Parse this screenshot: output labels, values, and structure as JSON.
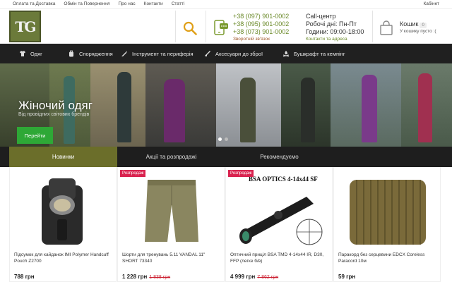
{
  "topbar": {
    "links": [
      "Оплата та Доставка",
      "Обмін та Повернення",
      "Про нас",
      "Контакти",
      "Статті"
    ],
    "cabinet": "Кабінет"
  },
  "header": {
    "logo_text": "TG",
    "phones": [
      "+38 (097) 901-0002",
      "+38 (095) 901-0002",
      "+38 (073) 901-0002"
    ],
    "callback": "Зворотній зв'язок",
    "call_center_title": "Call-центр",
    "work_days": "Робочі дні: Пн-Пт",
    "work_hours": "Години: 09:00-18:00",
    "contacts_link": "Контакти та адреса",
    "cart_title": "Кошик",
    "cart_count": "0",
    "cart_status": "У кошику пусто :("
  },
  "nav": {
    "items": [
      {
        "label": "Одяг",
        "icon": "shirt-icon"
      },
      {
        "label": "Спорядження",
        "icon": "backpack-icon"
      },
      {
        "label": "Інструмент та периферія",
        "icon": "knife-icon"
      },
      {
        "label": "Аксесуари до зброї",
        "icon": "rifle-icon"
      },
      {
        "label": "Бушкрафт та кемпінг",
        "icon": "campfire-icon"
      }
    ]
  },
  "hero": {
    "title": "Жіночий одяг",
    "subtitle": "Від провідних світових брендів",
    "button": "Перейти"
  },
  "tabs": [
    "Новинки",
    "Акції та розпродажі",
    "Рекомендуємо"
  ],
  "products": [
    {
      "name": "Підсумок для кайданок IMI Polymer Handcuff Pouch Z2700",
      "price": "788 грн",
      "old_price": "",
      "badge": ""
    },
    {
      "name": "Шорти для тренувань 5.11 VANDAL 11\" SHORT 73340",
      "price": "1 228 грн",
      "old_price": "1 838 грн",
      "badge": "Розпродаж"
    },
    {
      "name": "Оптичний приціл BSA TMD 4-14x44 IR, D30, FFP (легке б/в)",
      "price": "4 999 грн",
      "old_price": "7 862 грн",
      "badge": "Розпродаж",
      "image_text": "BSA OPTICS 4-14x44 SF"
    },
    {
      "name": "Паракорд без серцевини EDCX Coreless Paracord 10м",
      "price": "59 грн",
      "old_price": "",
      "badge": ""
    }
  ],
  "colors": {
    "accent_green": "#2ea836",
    "olive": "#6b6e2a",
    "nav_bg": "#202020",
    "sale": "#d9234f"
  }
}
